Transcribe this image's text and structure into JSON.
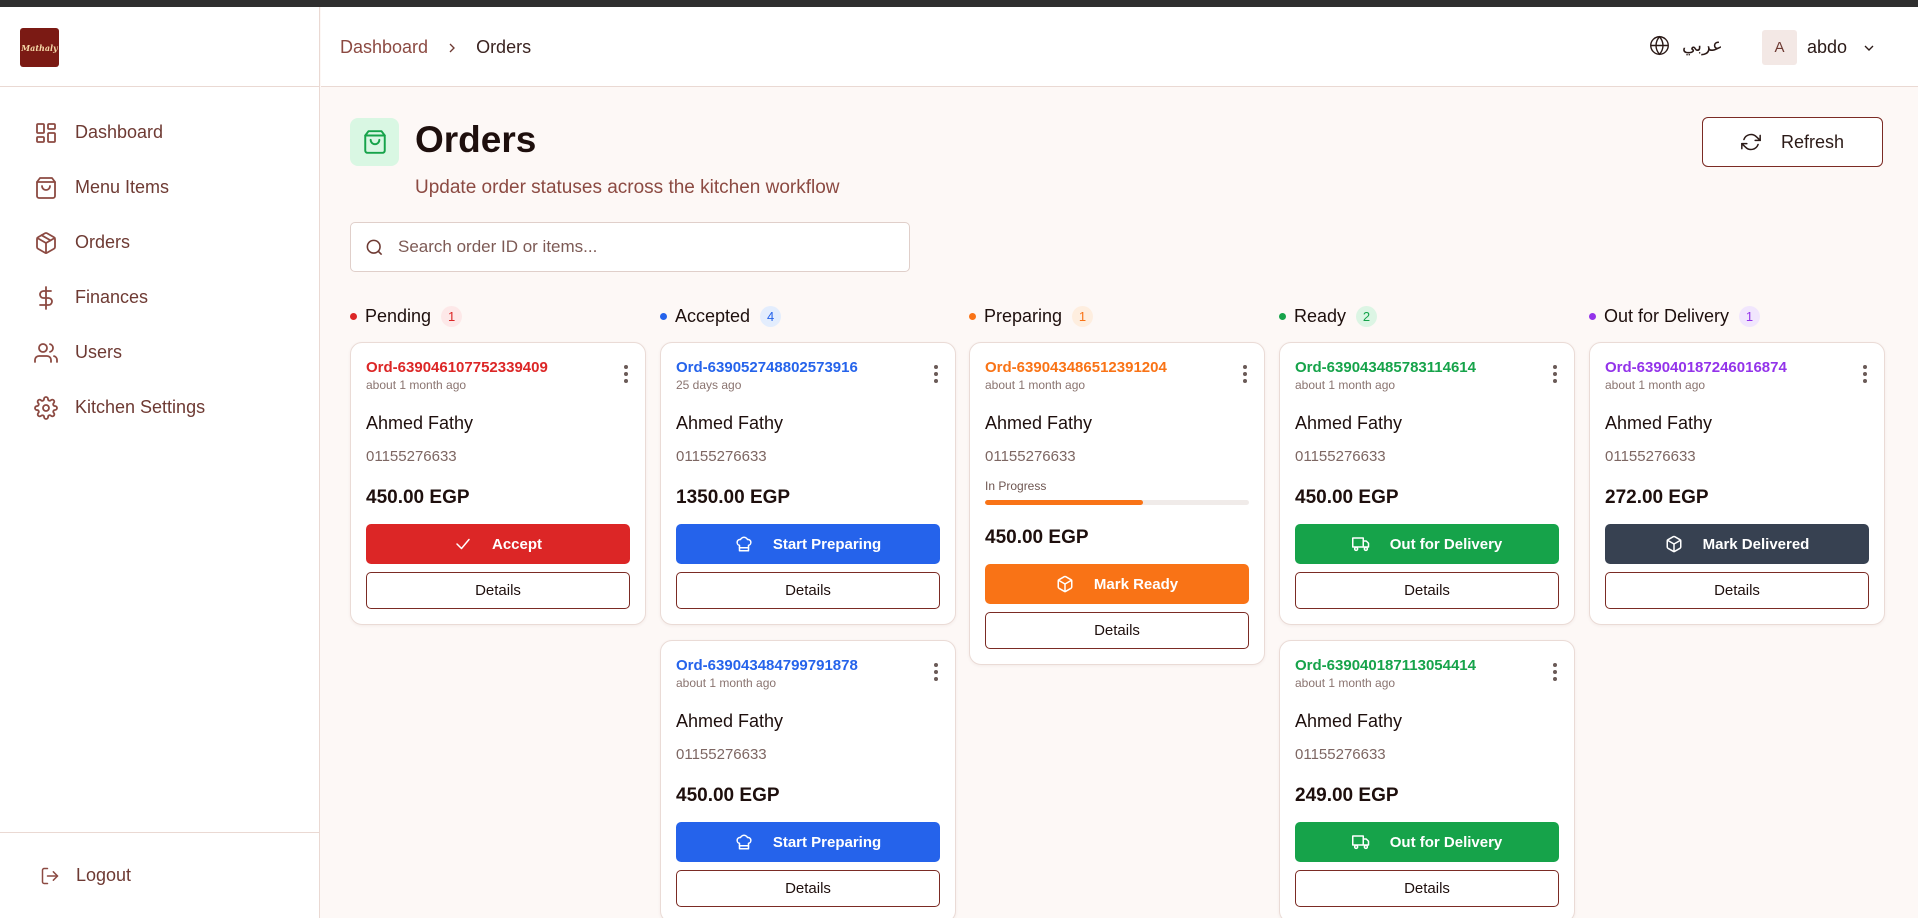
{
  "sidebar": {
    "logo_text": "Mathaly",
    "items": [
      {
        "label": "Dashboard",
        "icon": "grid-icon"
      },
      {
        "label": "Menu Items",
        "icon": "shopping-bag-icon"
      },
      {
        "label": "Orders",
        "icon": "package-icon"
      },
      {
        "label": "Finances",
        "icon": "dollar-icon"
      },
      {
        "label": "Users",
        "icon": "users-icon"
      },
      {
        "label": "Kitchen Settings",
        "icon": "gear-icon"
      }
    ],
    "logout_label": "Logout"
  },
  "header": {
    "breadcrumb": {
      "root": "Dashboard",
      "current": "Orders"
    },
    "language_label": "عربي",
    "user": {
      "initial": "A",
      "name": "abdo"
    }
  },
  "page": {
    "title": "Orders",
    "subtitle": "Update order statuses across the kitchen workflow",
    "refresh_label": "Refresh",
    "search_placeholder": "Search order ID or items..."
  },
  "colors": {
    "pending": "#dc2626",
    "accepted": "#2563eb",
    "preparing": "#f97316",
    "ready": "#16a34a",
    "out_for_delivery": "#9333ea",
    "delivered_button": "#374151"
  },
  "columns": [
    {
      "title": "Pending",
      "count": "1",
      "orders": [
        {
          "id": "Ord-639046107752339409",
          "time": "about 1 month ago",
          "customer": "Ahmed Fathy",
          "phone": "01155276633",
          "total": "450.00 EGP",
          "action": "Accept",
          "details": "Details"
        }
      ]
    },
    {
      "title": "Accepted",
      "count": "4",
      "orders": [
        {
          "id": "Ord-639052748802573916",
          "time": "25 days ago",
          "customer": "Ahmed Fathy",
          "phone": "01155276633",
          "total": "1350.00 EGP",
          "action": "Start Preparing",
          "details": "Details"
        },
        {
          "id": "Ord-639043484799791878",
          "time": "about 1 month ago",
          "customer": "Ahmed Fathy",
          "phone": "01155276633",
          "total": "450.00 EGP",
          "action": "Start Preparing",
          "details": "Details"
        }
      ]
    },
    {
      "title": "Preparing",
      "count": "1",
      "orders": [
        {
          "id": "Ord-639043486512391204",
          "time": "about 1 month ago",
          "customer": "Ahmed Fathy",
          "phone": "01155276633",
          "progress_label": "In Progress",
          "progress": 0.6,
          "total": "450.00 EGP",
          "action": "Mark Ready",
          "details": "Details"
        }
      ]
    },
    {
      "title": "Ready",
      "count": "2",
      "orders": [
        {
          "id": "Ord-639043485783114614",
          "time": "about 1 month ago",
          "customer": "Ahmed Fathy",
          "phone": "01155276633",
          "total": "450.00 EGP",
          "action": "Out for Delivery",
          "details": "Details"
        },
        {
          "id": "Ord-639040187113054414",
          "time": "about 1 month ago",
          "customer": "Ahmed Fathy",
          "phone": "01155276633",
          "total": "249.00 EGP",
          "action": "Out for Delivery",
          "details": "Details"
        }
      ]
    },
    {
      "title": "Out for Delivery",
      "count": "1",
      "orders": [
        {
          "id": "Ord-639040187246016874",
          "time": "about 1 month ago",
          "customer": "Ahmed Fathy",
          "phone": "01155276633",
          "total": "272.00 EGP",
          "action": "Mark Delivered",
          "details": "Details"
        }
      ]
    }
  ]
}
